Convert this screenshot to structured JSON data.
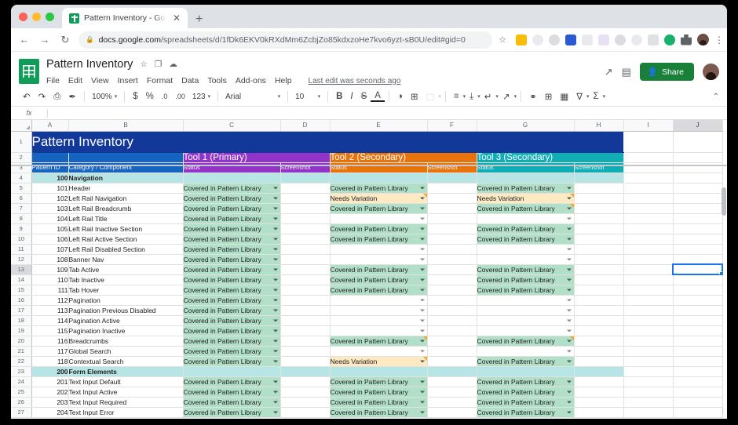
{
  "browser": {
    "tab_title": "Pattern Inventory - Google She",
    "tab_close": "✕",
    "new_tab": "+",
    "back": "←",
    "forward": "→",
    "reload": "↻",
    "lock": "🔒",
    "url_domain": "docs.google.com",
    "url_path": "/spreadsheets/d/1fDk6EKV0kRXdMm6ZcbjZo85kdxzoHe7kvo6yzt-sB0U/edit#gid=0",
    "star": "☆",
    "menu": "⋮"
  },
  "doc": {
    "name": "Pattern Inventory",
    "star_icon": "☆",
    "move_icon": "❐",
    "cloud_icon": "☁",
    "menus": [
      "File",
      "Edit",
      "View",
      "Insert",
      "Format",
      "Data",
      "Tools",
      "Add-ons",
      "Help"
    ],
    "last_edit": "Last edit was seconds ago",
    "trend_icon": "↗",
    "comment_icon": "▤",
    "share_label": "Share",
    "share_icon": "▲"
  },
  "toolbar": {
    "undo": "↶",
    "redo": "↷",
    "print": "⎙",
    "paint": "✒",
    "zoom": "100%",
    "currency": "$",
    "percent": "%",
    "dec_decrease": ".0",
    "dec_increase": ".00",
    "more_formats": "123",
    "font": "Arial",
    "font_size": "10",
    "bold": "B",
    "italic": "I",
    "strike": "S",
    "text_color": "A",
    "fill_color": "◑",
    "borders": "⊞",
    "merge": "⬚",
    "h_align": "≡",
    "v_align": "⤓",
    "wrap": "↵",
    "rotate": "↗",
    "link": "⚭",
    "comment": "⊞",
    "chart": "Ὄa",
    "filter": "∇",
    "functions": "Σ",
    "collapse": "⌃",
    "caret": "▾"
  },
  "formula_bar": {
    "fx": "fx",
    "value": ""
  },
  "sheet": {
    "columns": [
      "A",
      "B",
      "C",
      "D",
      "E",
      "F",
      "G",
      "H",
      "I",
      "J"
    ],
    "selected_column": "J",
    "selected_cell_row": 13,
    "selected_cell_col": "J",
    "title": "Pattern Inventory",
    "groups": [
      {
        "label": "Tool 1 (Primary)",
        "color": "#9334c9",
        "cols": [
          "C",
          "D"
        ]
      },
      {
        "label": "Tool 2 (Secondary)",
        "color": "#e8730b",
        "cols": [
          "E",
          "F"
        ]
      },
      {
        "label": "Tool 3 (Secondary)",
        "color": "#10aeb4",
        "cols": [
          "G",
          "H"
        ]
      }
    ],
    "subheaders": {
      "a": "Pattern ID",
      "b": "Category / Component",
      "status": "Status",
      "screenshot": "Screenshot"
    },
    "status_values": {
      "covered": "Covered in Pattern Library",
      "needs": "Needs Variation"
    },
    "rows": [
      {
        "r": 4,
        "id": "100",
        "name": "Navigation",
        "group": true,
        "c": "",
        "e": "",
        "g": ""
      },
      {
        "r": 5,
        "id": "101",
        "name": "Header",
        "group": false,
        "c": "covered",
        "e": "covered",
        "g": "covered"
      },
      {
        "r": 6,
        "id": "102",
        "name": "Left Rail Navigation",
        "group": false,
        "c": "covered",
        "e": "needs",
        "g": "needs",
        "flag_e": true,
        "flag_g": true
      },
      {
        "r": 7,
        "id": "103",
        "name": "Left Rail Breadcrumb",
        "group": false,
        "c": "covered",
        "e": "covered",
        "g": "covered",
        "flag_g": true
      },
      {
        "r": 8,
        "id": "104",
        "name": "Left Rail Title",
        "group": false,
        "c": "covered",
        "e": "",
        "g": ""
      },
      {
        "r": 9,
        "id": "105",
        "name": "Left Rail Inactive Section",
        "group": false,
        "c": "covered",
        "e": "covered",
        "g": "covered"
      },
      {
        "r": 10,
        "id": "106",
        "name": "Left Rail Active Section",
        "group": false,
        "c": "covered",
        "e": "covered",
        "g": "covered"
      },
      {
        "r": 11,
        "id": "107",
        "name": "Left Rail Disabled Section",
        "group": false,
        "c": "covered",
        "e": "",
        "g": ""
      },
      {
        "r": 12,
        "id": "108",
        "name": "Banner Nav",
        "group": false,
        "c": "covered",
        "e": "",
        "g": ""
      },
      {
        "r": 13,
        "id": "109",
        "name": "Tab Active",
        "group": false,
        "c": "covered",
        "e": "covered",
        "g": "covered"
      },
      {
        "r": 14,
        "id": "110",
        "name": "Tab Inactive",
        "group": false,
        "c": "covered",
        "e": "covered",
        "g": "covered"
      },
      {
        "r": 15,
        "id": "111",
        "name": "Tab Hover",
        "group": false,
        "c": "covered",
        "e": "covered",
        "g": "covered"
      },
      {
        "r": 16,
        "id": "112",
        "name": "Pagination",
        "group": false,
        "c": "covered",
        "e": "",
        "g": ""
      },
      {
        "r": 17,
        "id": "113",
        "name": "Pagination Previous Disabled",
        "group": false,
        "c": "covered",
        "e": "",
        "g": ""
      },
      {
        "r": 18,
        "id": "114",
        "name": "Pagination Active",
        "group": false,
        "c": "covered",
        "e": "",
        "g": ""
      },
      {
        "r": 19,
        "id": "115",
        "name": "Pagination Inactive",
        "group": false,
        "c": "covered",
        "e": "",
        "g": ""
      },
      {
        "r": 20,
        "id": "116",
        "name": "Breadcrumbs",
        "group": false,
        "c": "covered",
        "e": "covered",
        "g": "covered",
        "flag_e": true,
        "flag_g": true
      },
      {
        "r": 21,
        "id": "117",
        "name": "Global Search",
        "group": false,
        "c": "covered",
        "e": "",
        "g": ""
      },
      {
        "r": 22,
        "id": "118",
        "name": "Contextual Search",
        "group": false,
        "c": "covered",
        "e": "needs",
        "g": "covered",
        "flag_e": true
      },
      {
        "r": 23,
        "id": "200",
        "name": "Form Elements",
        "group": true,
        "c": "",
        "e": "",
        "g": ""
      },
      {
        "r": 24,
        "id": "201",
        "name": "Text Input Default",
        "group": false,
        "c": "covered",
        "e": "covered",
        "g": "covered"
      },
      {
        "r": 25,
        "id": "202",
        "name": "Text Input Active",
        "group": false,
        "c": "covered",
        "e": "covered",
        "g": "covered"
      },
      {
        "r": 26,
        "id": "203",
        "name": "Text Input Required",
        "group": false,
        "c": "covered",
        "e": "covered",
        "g": "covered"
      },
      {
        "r": 27,
        "id": "204",
        "name": "Text Input Error",
        "group": false,
        "c": "covered",
        "e": "covered",
        "g": "covered"
      }
    ]
  }
}
